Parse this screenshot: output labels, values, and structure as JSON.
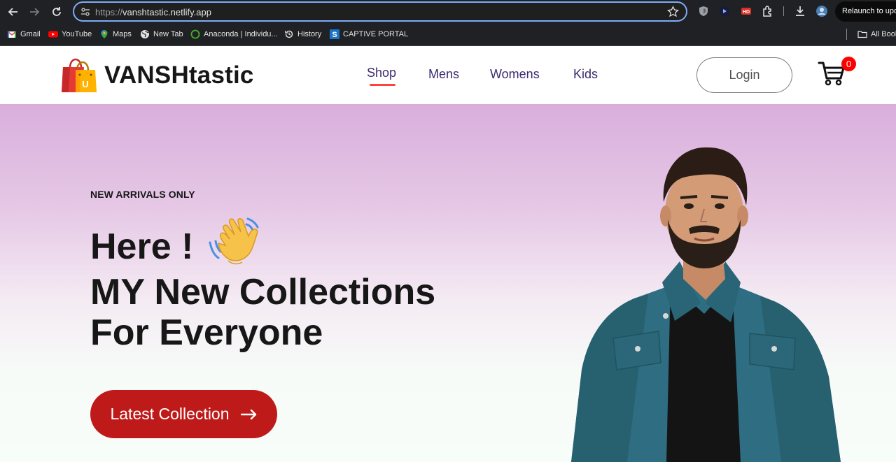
{
  "browser": {
    "url_scheme": "https://",
    "url_host": "vanshtastic.netlify.app",
    "relaunch_label": "Relaunch to upda",
    "bookmarks": [
      {
        "label": "Gmail",
        "icon": "gmail-icon"
      },
      {
        "label": "YouTube",
        "icon": "youtube-icon"
      },
      {
        "label": "Maps",
        "icon": "maps-icon"
      },
      {
        "label": "New Tab",
        "icon": "globe-icon"
      },
      {
        "label": "Anaconda | Individu...",
        "icon": "anaconda-icon"
      },
      {
        "label": "History",
        "icon": "history-icon"
      },
      {
        "label": "CAPTIVE PORTAL",
        "icon": "captive-portal-icon"
      }
    ],
    "all_bookmarks_label": "All Book"
  },
  "site": {
    "brand": "VANSHtastic",
    "nav": [
      {
        "label": "Shop",
        "active": true
      },
      {
        "label": "Mens",
        "active": false
      },
      {
        "label": "Womens",
        "active": false
      },
      {
        "label": "Kids",
        "active": false
      }
    ],
    "login_label": "Login",
    "cart_count": "0"
  },
  "hero": {
    "kicker": "NEW ARRIVALS ONLY",
    "line1": "Here !",
    "line2": "MY New Collections",
    "line3": "For Everyone",
    "cta_label": "Latest Collection"
  },
  "colors": {
    "accent_red": "#bf1a1a",
    "nav_text": "#3c2a6e",
    "nav_underline": "#ff4141",
    "cart_badge": "#ff0000"
  }
}
